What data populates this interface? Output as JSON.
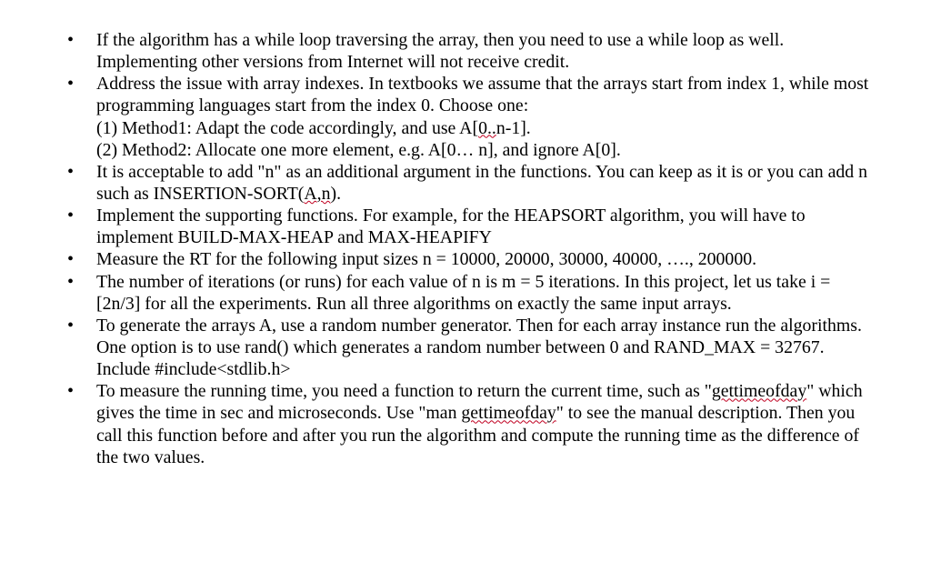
{
  "bullets": [
    {
      "text": "If the algorithm has a while loop traversing the array, then you need to use a while loop as well. Implementing other versions from Internet will not receive credit."
    },
    {
      "lead": "Address the issue with array indexes. In textbooks we assume that the arrays start from index 1, while most programming languages start from the index 0. Choose one:",
      "sub1_a": "(1) Method1: Adapt the code accordingly, and use A[",
      "sub1_sq": "0..",
      "sub1_b": "n-1].",
      "sub2": "(2) Method2: Allocate one more element, e.g. A[0… n], and ignore A[0]."
    },
    {
      "a": "It is acceptable to add \"n\" as an additional argument in the functions. You can keep as it is or you can add n such as INSERTION-SORT(",
      "sq": "A,n",
      "b": ")."
    },
    {
      "text": "Implement the supporting functions. For example, for the HEAPSORT algorithm, you will have to implement BUILD-MAX-HEAP and MAX-HEAPIFY"
    },
    {
      "text": "Measure the RT for the following input sizes n = 10000, 20000, 30000, 40000, …., 200000."
    },
    {
      "text": "The number of iterations (or runs) for each value of n is m = 5 iterations. In this project, let us take i = [2n/3] for all the experiments. Run all three algorithms on exactly the same input arrays."
    },
    {
      "text": "To generate the arrays A, use a random number generator. Then for each array instance run the algorithms. One option is to use rand() which generates a random number between 0 and RAND_MAX = 32767. Include #include<stdlib.h>"
    },
    {
      "a": "To measure the running time, you need a function to return the current time, such as \"",
      "sq1": "gettimeofday",
      "b": "\" which gives the time in sec and microseconds. Use \"man ",
      "sq2": "gettimeofday",
      "c": "\" to see the manual description. Then you call this function before and after you run the algorithm and compute the running time as the difference of the two values."
    }
  ]
}
